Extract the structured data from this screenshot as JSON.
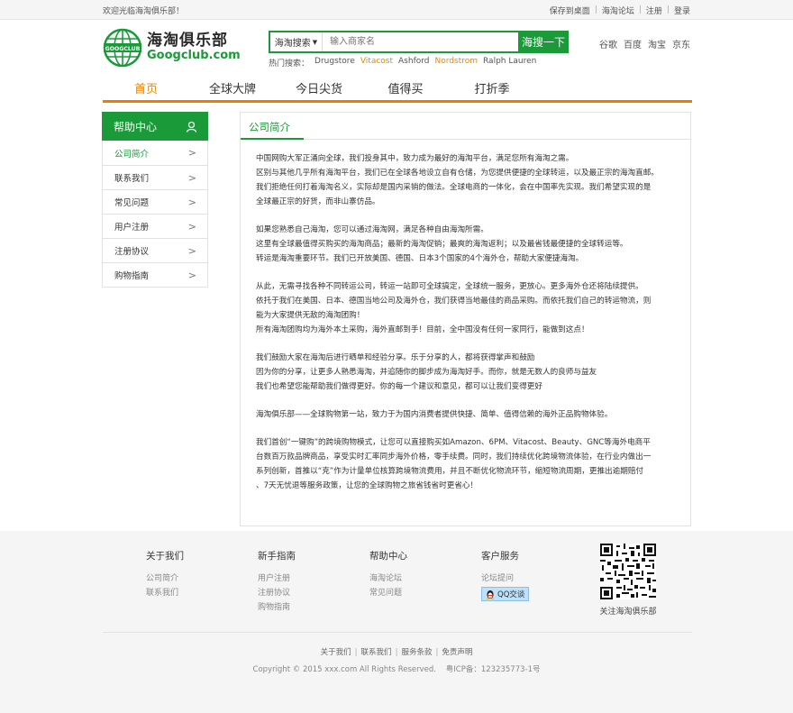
{
  "topbar": {
    "welcome": "欢迎光临海淘俱乐部！",
    "links": [
      "保存到桌面",
      "海淘论坛",
      "注册",
      "登录"
    ]
  },
  "logo": {
    "cn": "海淘俱乐部",
    "en": "Googclub.com",
    "badge": "GOOGCLUB"
  },
  "search": {
    "select": "海淘搜索",
    "placeholder": "输入商家名",
    "button": "海搜一下",
    "hot_label": "热门搜索：",
    "hot_terms": [
      "Drugstore",
      "Vitacost",
      "Ashford",
      "Nordstrom",
      "Ralph Lauren"
    ]
  },
  "engines": [
    "谷歌",
    "百度",
    "淘宝",
    "京东"
  ],
  "nav": {
    "items": [
      "首页",
      "全球大牌",
      "今日尖货",
      "值得买",
      "打折季"
    ]
  },
  "sidebar": {
    "title": "帮助中心",
    "items": [
      "公司简介",
      "联系我们",
      "常见问题",
      "用户注册",
      "注册协议",
      "购物指南"
    ]
  },
  "content": {
    "title": "公司简介",
    "paragraphs": [
      [
        "中国网购大军正涌向全球，我们投身其中，致力成为最好的海淘平台，满足您所有海淘之需。",
        "区别与其他几乎所有海淘平台，我们已在全球各地设立自有仓储，为您提供便捷的全球转运，以及最正宗的海淘直邮。",
        "我们拒绝任何打着海淘名义，实际却是国内采销的做法。全球电商的一体化，会在中国率先实现。我们希望实现的是",
        "全球最正宗的好货，而非山寨仿品。"
      ],
      [
        "如果您熟悉自己海淘，您可以通过海淘网，满足各种自由海淘所需。",
        "这里有全球最值得买购买的海淘商品；最新的海淘促销；最爽的海淘返利；以及最省钱最便捷的全球转运等。",
        "转运是海淘重要环节。我们已开放美国、德国、日本3个国家的4个海外仓，帮助大家便捷海淘。"
      ],
      [
        "从此，无需寻找各种不同转运公司，转运一站即可全球搞定，全球统一服务，更放心。更多海外仓还将陆续提供。",
        "依托于我们在美国、日本、德国当地公司及海外仓，我们获得当地最佳的商品采购。而依托我们自己的转运物流，则",
        "能为大家提供无敌的海淘团购！",
        "所有海淘团购均为海外本土采购，海外直邮到手！目前，全中国没有任何一家同行，能做到这点！"
      ],
      [
        "我们鼓励大家在海淘后进行晒单和经验分享。乐于分享的人，都将获得掌声和鼓励",
        "因为你的分享，让更多人熟悉海淘，并追随你的脚步成为海淘好手。而你，就是无数人的良师与益友",
        "我们也希望您能帮助我们做得更好。你的每一个建议和意见，都可以让我们变得更好"
      ],
      [
        "海淘俱乐部——全球购物第一站，致力于为国内消费者提供快捷、简单、值得信赖的海外正品购物体验。"
      ],
      [
        "我们首创“一键购”的跨境购物模式，让您可以直接购买如Amazon、6PM、Vitacost、Beauty、GNC等海外电商平",
        "台数百万款品牌商品，享受实时汇率同步海外价格，零手续费。同时，我们持续优化跨境物流体验，在行业内做出一",
        "系列创新，首推以“克”作为计量单位核算跨境物流费用，并且不断优化物流环节，缩短物流周期，更推出逾期赔付",
        "、7天无忧退等服务政策，让您的全球购物之旅省钱省时更省心！"
      ]
    ]
  },
  "footer": {
    "columns": [
      {
        "title": "关于我们",
        "links": [
          "公司简介",
          "联系我们"
        ]
      },
      {
        "title": "新手指南",
        "links": [
          "用户注册",
          "注册协议",
          "购物指南"
        ]
      },
      {
        "title": "帮助中心",
        "links": [
          "海淘论坛",
          "常见问题"
        ]
      },
      {
        "title": "客户服务",
        "links": [
          "论坛提问"
        ],
        "qq": "QQ交谈"
      }
    ],
    "qr_caption": "关注海淘俱乐部",
    "bottom_links": [
      "关于我们",
      "联系我们",
      "服务条款",
      "免责声明"
    ],
    "copyright": "Copyright © 2015 xxx.com All Rights Reserved.",
    "icp": "粤ICP备：123235773-1号"
  },
  "colors": {
    "brand_green": "#1a9a38",
    "accent_orange": "#f57b00"
  }
}
